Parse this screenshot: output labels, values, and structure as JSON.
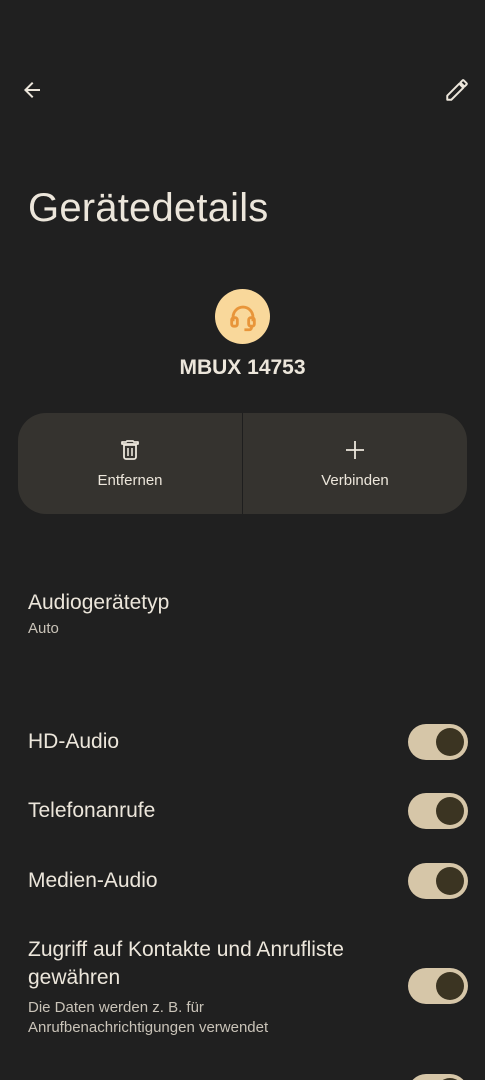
{
  "header": {
    "back_icon": "arrow-back-icon",
    "edit_icon": "pencil-icon",
    "title": "Gerätedetails"
  },
  "device": {
    "icon": "headset-icon",
    "avatar_color": "#F9D89B",
    "name": "MBUX 14753"
  },
  "actions": [
    {
      "icon": "trash-icon",
      "label": "Entfernen"
    },
    {
      "icon": "plus-icon",
      "label": "Verbinden"
    }
  ],
  "audio_device_type": {
    "title": "Audiogerätetyp",
    "value": "Auto"
  },
  "toggles": [
    {
      "title": "HD-Audio",
      "on": true
    },
    {
      "title": "Telefonanrufe",
      "on": true
    },
    {
      "title": "Medien-Audio",
      "on": true
    },
    {
      "title": "Zugriff auf Kontakte und Anrufliste gewähren",
      "subtitle": "Die Daten werden z. B. für Anrufbenachrichtigungen verwendet",
      "on": true
    }
  ],
  "colors": {
    "background": "#202020",
    "card": "#35332F",
    "text": "#ECE6DB",
    "switch_track_on": "#D6C6A8",
    "switch_thumb_on": "#3B3422"
  }
}
